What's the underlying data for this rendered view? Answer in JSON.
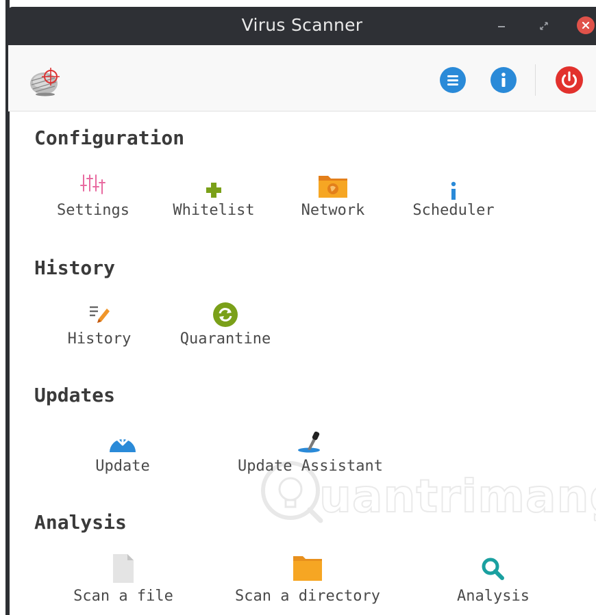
{
  "window": {
    "title": "Virus Scanner"
  },
  "colors": {
    "titlebar": "#2e3035",
    "accent_blue": "#2a8ad8",
    "power_red": "#e2312d",
    "close_red": "#e0524a",
    "settings_pink": "#e86aa0",
    "whitelist_green": "#7aa019",
    "network_orange": "#f0962a",
    "quarantine_olive": "#7aa019",
    "folder_orange": "#f6a623"
  },
  "toolbar": {
    "logo_icon": "virus-target-icon",
    "menu_icon": "list-menu-icon",
    "info_icon": "info-icon",
    "power_icon": "power-icon"
  },
  "sections": {
    "configuration": {
      "title": "Configuration",
      "items": [
        {
          "label": "Settings",
          "icon": "sliders-icon"
        },
        {
          "label": "Whitelist",
          "icon": "plus-icon"
        },
        {
          "label": "Network",
          "icon": "network-folder-icon"
        },
        {
          "label": "Scheduler",
          "icon": "info-small-icon"
        }
      ]
    },
    "history": {
      "title": "History",
      "items": [
        {
          "label": "History",
          "icon": "edit-list-icon"
        },
        {
          "label": "Quarantine",
          "icon": "refresh-circle-icon"
        }
      ]
    },
    "updates": {
      "title": "Updates",
      "items": [
        {
          "label": "Update",
          "icon": "download-icon"
        },
        {
          "label": "Update Assistant",
          "icon": "dropper-icon"
        }
      ]
    },
    "analysis": {
      "title": "Analysis",
      "items": [
        {
          "label": "Scan a file",
          "icon": "file-icon"
        },
        {
          "label": "Scan a directory",
          "icon": "folder-icon"
        },
        {
          "label": "Analysis",
          "icon": "magnifier-icon"
        }
      ]
    }
  },
  "watermark": {
    "text": "uantrimang",
    "initial": "Q"
  }
}
